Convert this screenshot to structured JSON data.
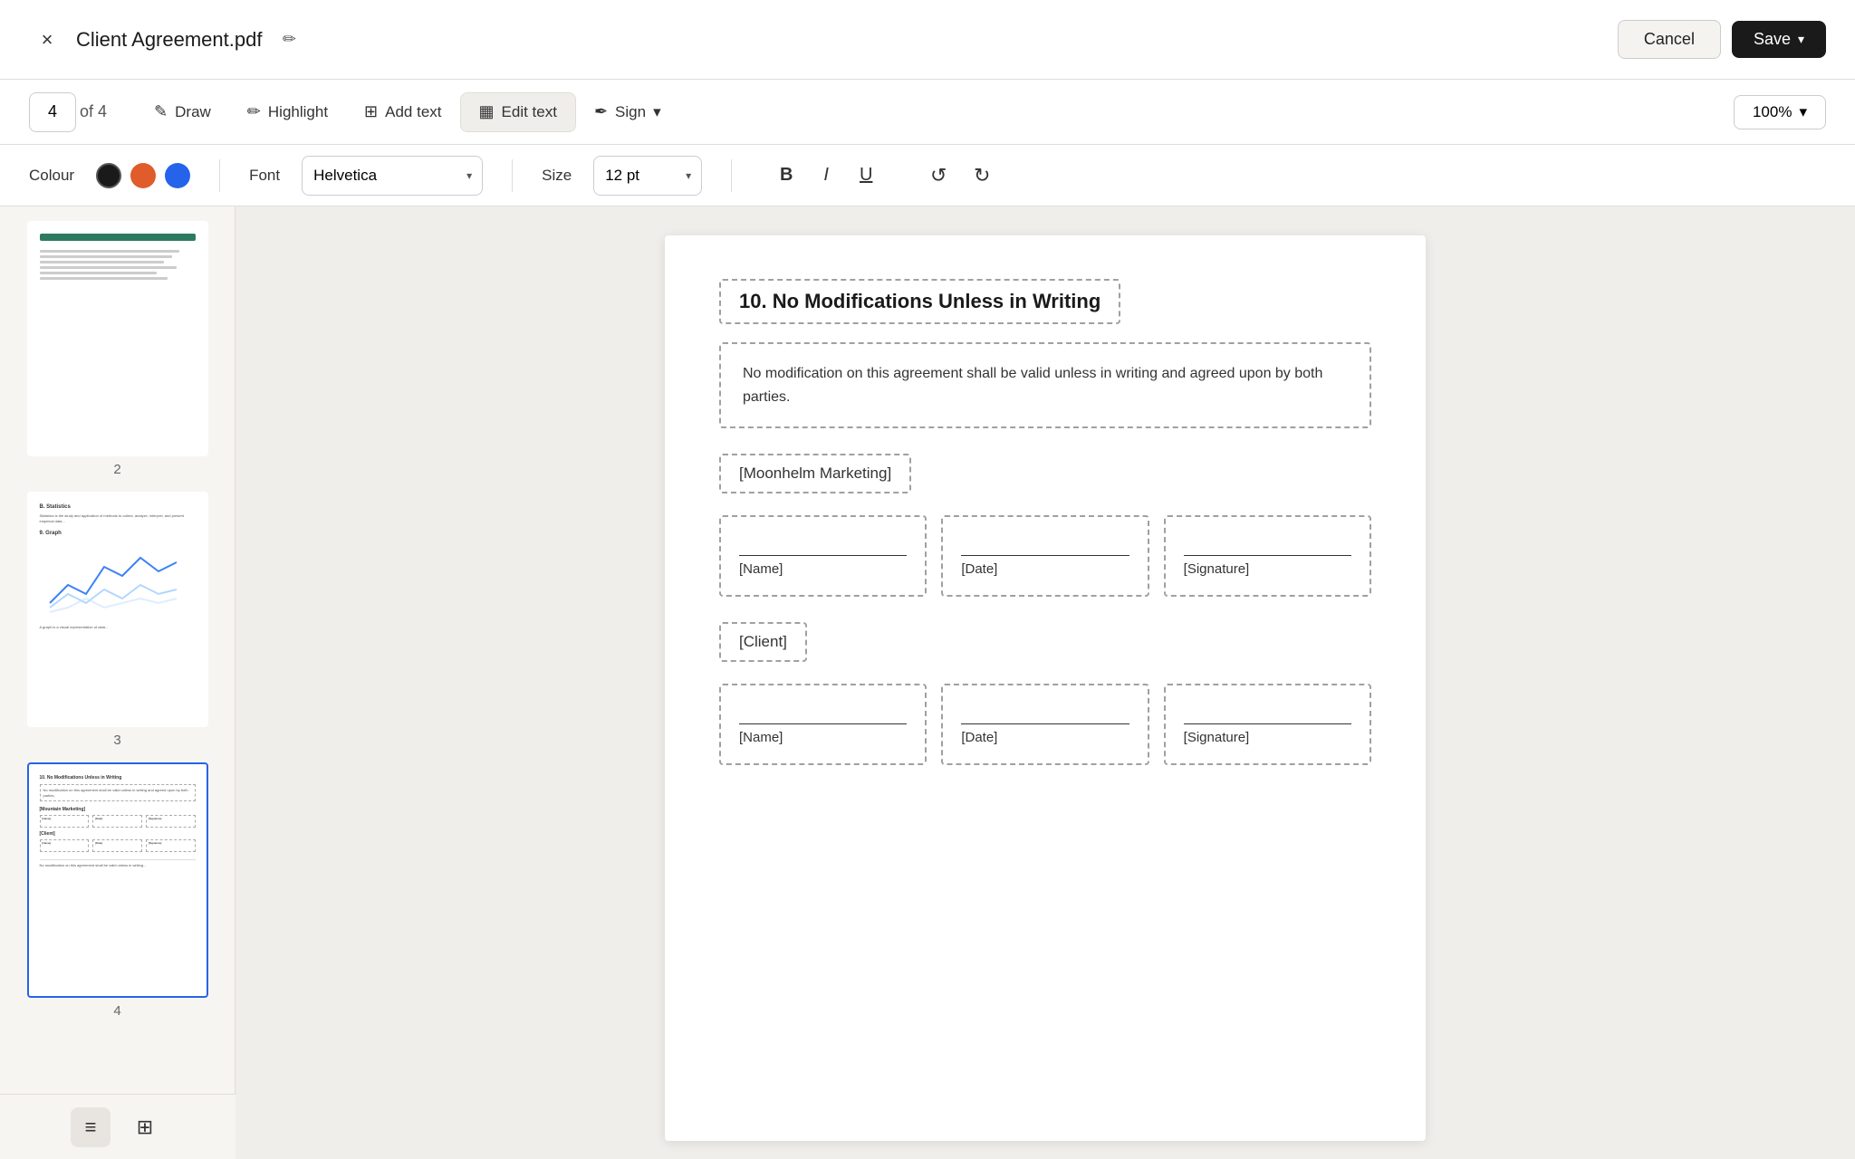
{
  "header": {
    "title": "Client Agreement.pdf",
    "close_label": "×",
    "edit_icon": "✏",
    "cancel_label": "Cancel",
    "save_label": "Save",
    "save_chevron": "▾"
  },
  "toolbar": {
    "page_current": "4",
    "page_of": "of 4",
    "draw_label": "Draw",
    "highlight_label": "Highlight",
    "add_text_label": "Add text",
    "edit_text_label": "Edit text",
    "sign_label": "Sign",
    "zoom_label": "100%"
  },
  "format_bar": {
    "colour_label": "Colour",
    "font_label": "Font",
    "size_label": "Size",
    "font_value": "Helvetica",
    "size_value": "12 pt",
    "colors": [
      "#1a1a1a",
      "#e05c2a",
      "#2563eb"
    ],
    "bold_label": "B",
    "italic_label": "I",
    "underline_label": "U"
  },
  "sidebar": {
    "pages": [
      {
        "num": "2",
        "active": false
      },
      {
        "num": "3",
        "active": false
      },
      {
        "num": "4",
        "active": true
      }
    ]
  },
  "document": {
    "section_title": "10. No Modifications Unless in Writing",
    "section_body": "No modification on this agreement shall be valid unless in writing and agreed upon by both parties.",
    "party1_label": "[Moonhelm Marketing]",
    "party2_label": "[Client]",
    "sig_fields": {
      "name": "[Name]",
      "date": "[Date]",
      "signature": "[Signature]"
    }
  },
  "bottom_bar": {
    "list_view_label": "≡",
    "grid_view_label": "⊞"
  }
}
